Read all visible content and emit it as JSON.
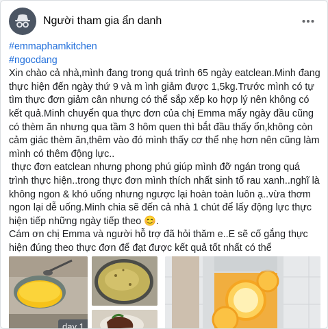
{
  "post": {
    "author": "Người tham gia ẩn danh",
    "hashtags": [
      "#emmaphamkitchen",
      "#ngocdang"
    ],
    "lines": [
      "Xin chào cả nhà,mình đang trong quá trình 65 ngày eatclean.Minh đang",
      "thực hiện đến ngày thứ 9 và m ình giảm được 1,5kg.Trước mình có tự",
      "tìm thực đơn giảm cân nhưng có thể sắp xếp ko hợp lý nên không có",
      "kết quả.Minh chuyển qua thực đơn của chị Emma mấy ngày đầu cũng",
      "có thèm ăn nhưng qua tầm 3 hôm quen thì bắt đầu thấy ổn,không còn",
      "cảm giác thèm ăn,thêm vào đó mình thấy cơ thể nhẹ hơn nên cũng làm",
      "mình có thêm động lực..",
      " thực đơn eatclean nhưng phong phú giúp mình đỡ ngán trong quá",
      "trình thực hiện..trong thực đơn mình thích nhất sinh tố rau xanh..nghĩ là",
      "không ngon & khó uống nhưng ngược lại hoàn toàn luôn ạ..vừa thơm",
      "ngon lại dễ uống.Minh chia sẽ đến cả nhà 1 chút để lấy động lực thực",
      "hiện tiếp những ngày tiếp theo 😊.",
      "Cám ơn chị Emma và người hỗ trợ đã hỏi thăm e..E sẽ cố gắng thực",
      "hiện đúng theo thực đơn để đạt được kết quả tốt nhất có thể"
    ],
    "photo_label": "day 1",
    "icons": {
      "avatar": "anonymous-spy-icon",
      "more": "more-horizontal-icon"
    },
    "colors": {
      "hashtag": "#216fdb",
      "text": "#1c1e21",
      "avatar_bg": "#4b5563"
    }
  }
}
